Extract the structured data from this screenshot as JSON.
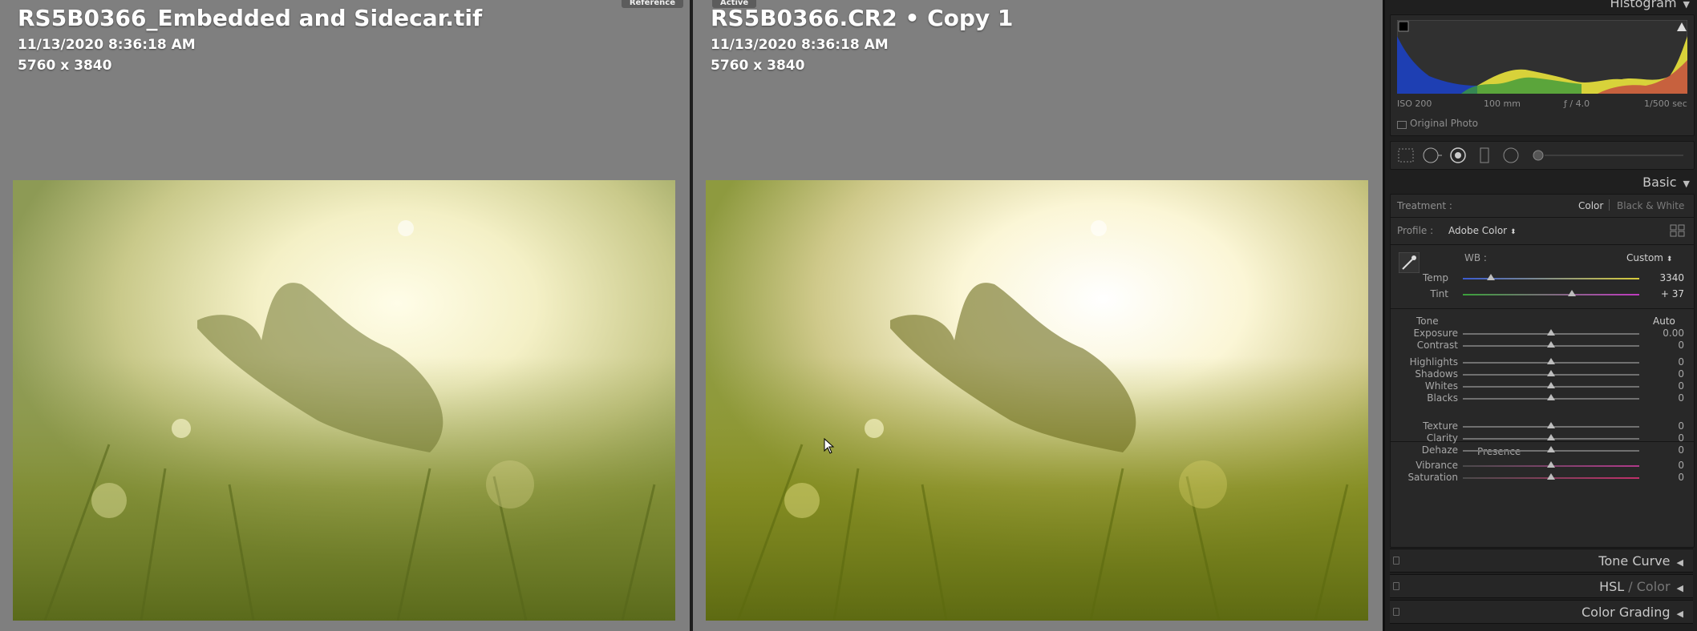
{
  "reference_pane": {
    "tab_label": "Reference",
    "title": "RS5B0366_Embedded and Sidecar.tif",
    "date": "11/13/2020 8:36:18 AM",
    "dimensions": "5760 x 3840"
  },
  "active_pane": {
    "tab_label": "Active",
    "title": "RS5B0366.CR2  •  Copy 1",
    "date": "11/13/2020 8:36:18 AM",
    "dimensions": "5760 x 3840"
  },
  "histogram": {
    "header": "Histogram",
    "iso": "ISO 200",
    "focal": "100 mm",
    "aperture": "ƒ / 4.0",
    "shutter": "1/500 sec",
    "original_photo_label": "Original Photo"
  },
  "tools": {
    "icons": [
      "crop-icon",
      "healing-icon",
      "masking-icon",
      "red-eye-icon",
      "radial-icon"
    ]
  },
  "basic": {
    "header": "Basic",
    "treatment_label": "Treatment :",
    "treatment_color": "Color",
    "treatment_bw": "Black & White",
    "profile_label": "Profile :",
    "profile_value": "Adobe Color",
    "wb_label": "WB :",
    "wb_value": "Custom",
    "temp_label": "Temp",
    "temp_value": "3340",
    "temp_level": 0.16,
    "tint_label": "Tint",
    "tint_value": "+ 37",
    "tint_level": 0.62,
    "tone_label": "Tone",
    "auto_label": "Auto",
    "tone_sliders": [
      {
        "label": "Exposure",
        "value": "0.00"
      },
      {
        "label": "Contrast",
        "value": "0"
      },
      {
        "label": "Highlights",
        "value": "0"
      },
      {
        "label": "Shadows",
        "value": "0"
      },
      {
        "label": "Whites",
        "value": "0"
      },
      {
        "label": "Blacks",
        "value": "0"
      }
    ],
    "presence_label": "Presence",
    "presence_sliders": [
      {
        "label": "Texture",
        "value": "0"
      },
      {
        "label": "Clarity",
        "value": "0"
      },
      {
        "label": "Dehaze",
        "value": "0"
      },
      {
        "label": "Vibrance",
        "value": "0"
      },
      {
        "label": "Saturation",
        "value": "0"
      }
    ]
  },
  "collapsed_panels": {
    "tone_curve": "Tone Curve",
    "hsl": "HSL",
    "hsl_sep": " / ",
    "color": "Color",
    "color_grading": "Color Grading"
  },
  "colors": {
    "panel_bg": "#282828",
    "image_bg": "#7f7f7f"
  }
}
